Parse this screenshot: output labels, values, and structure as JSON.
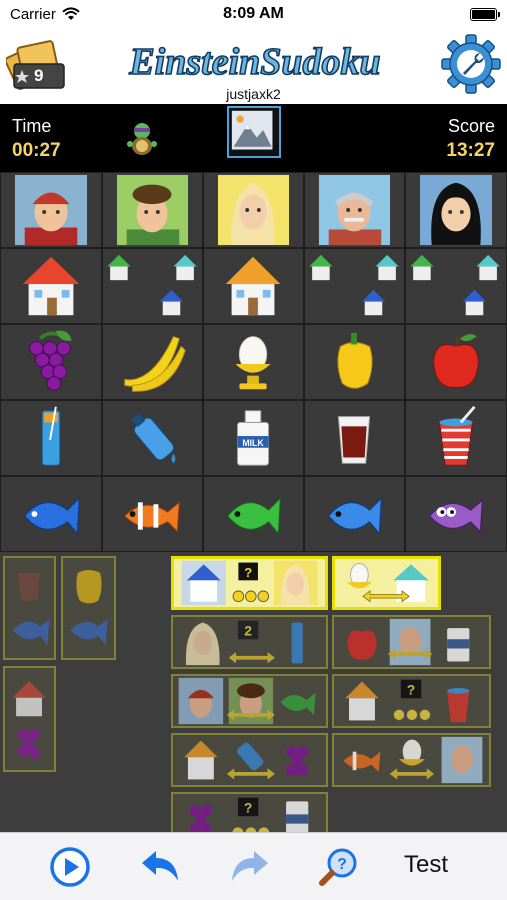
{
  "status": {
    "carrier": "Carrier",
    "time": "8:09 AM"
  },
  "header": {
    "tickets_count": "9",
    "title": "EinsteinSudoku",
    "username": "justjaxk2"
  },
  "scorebar": {
    "time_label": "Time",
    "time_value": "00:27",
    "score_label": "Score",
    "score_value": "13:27"
  },
  "clue_tokens": {
    "question": "?",
    "two": "2"
  },
  "toolbar": {
    "test_label": "Test"
  },
  "colors": {
    "accent_blue": "#1a73e8",
    "grid_bg": "#3a3a3a",
    "highlight": "#e5e000",
    "score_yellow": "#f4d56a"
  }
}
